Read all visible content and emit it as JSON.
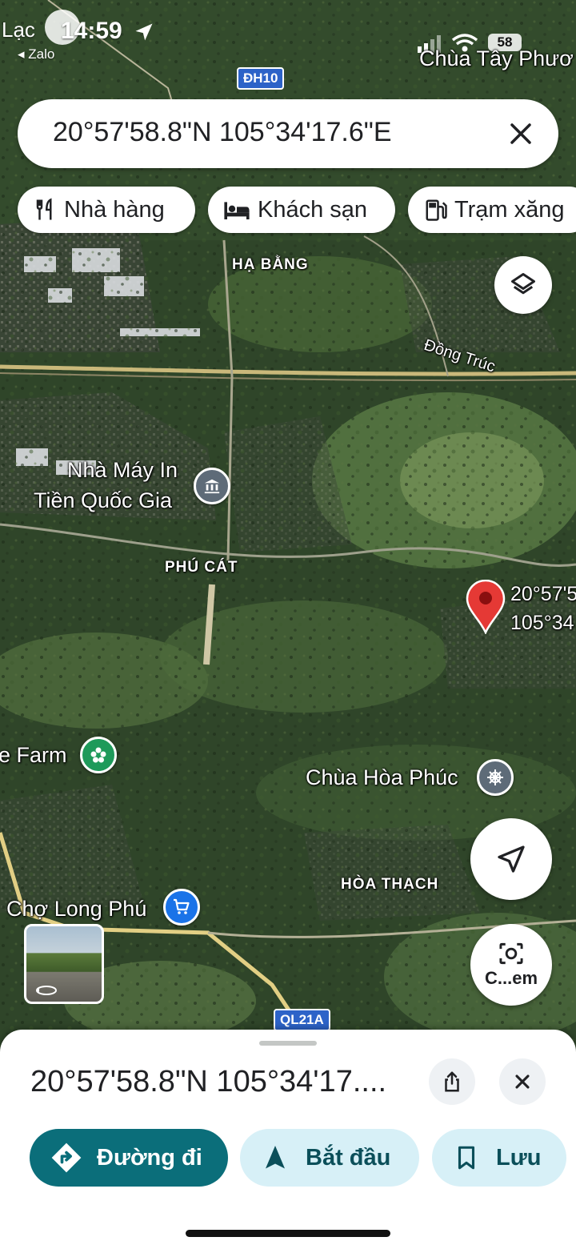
{
  "status_bar": {
    "back_app": "Lạc",
    "back_app_sub": "◂ Zalo",
    "time": "14:59",
    "battery": "58"
  },
  "search": {
    "value": "20°57'58.8\"N 105°34'17.6\"E"
  },
  "chips": [
    {
      "label": "Nhà hàng",
      "icon": "restaurant-icon"
    },
    {
      "label": "Khách sạn",
      "icon": "hotel-icon"
    },
    {
      "label": "Trạm xăng",
      "icon": "gas-station-icon"
    }
  ],
  "map": {
    "labels": {
      "chua_tay_phuong": "Chùa Tây Phươ",
      "ha_bang": "HẠ BẰNG",
      "dong_truc": "Đồng Trúc",
      "nha_may_line1": "Nhà Máy In",
      "nha_may_line2": "Tiền Quốc Gia",
      "phu_cat": "PHÚ CÁT",
      "farm": "e Farm",
      "chua_hoa_phuc": "Chùa Hòa Phúc",
      "hoa_thach": "HÒA THẠCH",
      "cho_long_phu": "Chợ Long Phú"
    },
    "shields": {
      "dh10": "ĐH10",
      "ql21a": "QL21A"
    },
    "pin_label_line1": "20°57'5",
    "pin_label_line2": "105°34",
    "camera_button_label": "C...em"
  },
  "sheet": {
    "title": "20°57'58.8\"N 105°34'17....",
    "actions": [
      {
        "label": "Đường đi",
        "icon": "directions-icon"
      },
      {
        "label": "Bắt đầu",
        "icon": "navigation-arrow-icon"
      },
      {
        "label": "Lưu",
        "icon": "bookmark-icon"
      }
    ]
  },
  "colors": {
    "primary": "#0b6e7a",
    "tonal": "#d7f0f7",
    "pin": "#e53935"
  }
}
